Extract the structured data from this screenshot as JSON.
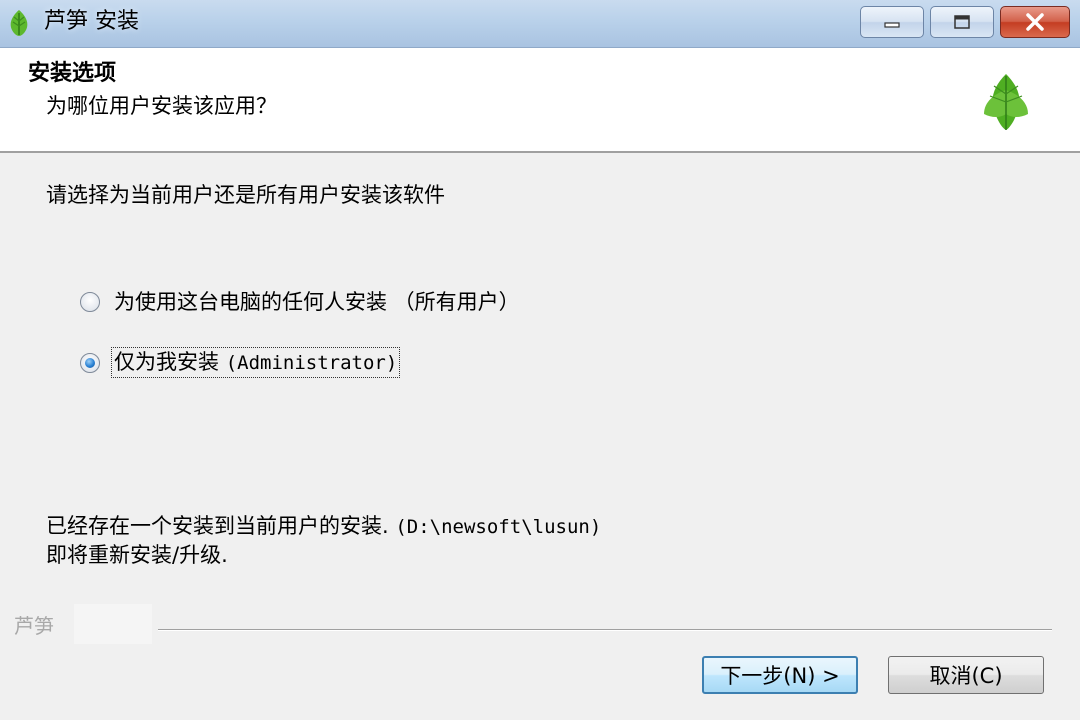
{
  "window": {
    "title": "芦笋 安装",
    "icon": "leaf-icon",
    "controls": [
      "minimize-icon",
      "maximize-icon",
      "close-icon"
    ]
  },
  "header": {
    "title": "安装选项",
    "subtitle": "为哪位用户安装该应用？",
    "logo": "leaf-logo-icon"
  },
  "body": {
    "prompt": "请选择为当前用户还是所有用户安装该软件",
    "options": [
      {
        "label": "为使用这台电脑的任何人安装 （所有用户）",
        "selected": false
      },
      {
        "label_prefix": "仅为我安装 ",
        "label_mono": "(Administrator)",
        "selected": true
      }
    ],
    "notice_line1_text": "已经存在一个安装到当前用户的安装. ",
    "notice_line1_path": "(D:\\newsoft\\lusun)",
    "notice_line2": "即将重新安装/升级."
  },
  "footer": {
    "brand": "芦笋",
    "next_label": "下一步(N) >",
    "cancel_label": "取消(C)"
  },
  "colors": {
    "titlebar": "#b9d1ea",
    "close_button": "#c43d22",
    "leaf_green": "#5db82e",
    "default_button_border": "#3c7fb1"
  }
}
